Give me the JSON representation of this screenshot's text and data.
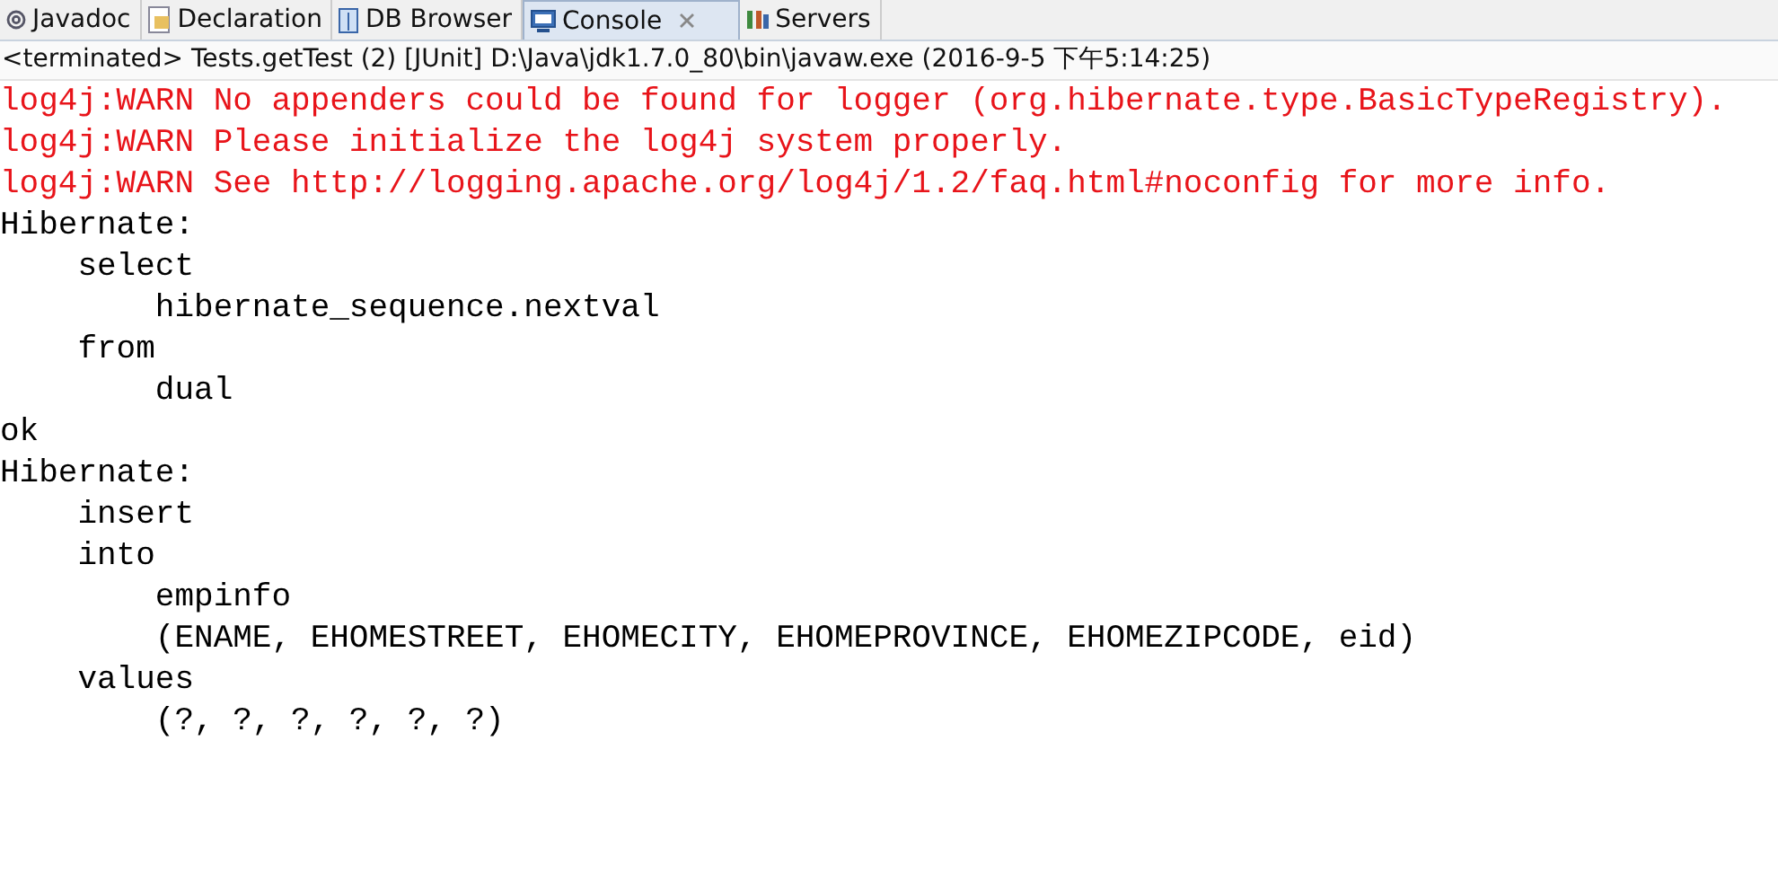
{
  "tabs": [
    {
      "label": "Javadoc",
      "kind": "javadoc",
      "selected": false,
      "closable": false
    },
    {
      "label": "Declaration",
      "kind": "declaration",
      "selected": false,
      "closable": false
    },
    {
      "label": "DB Browser",
      "kind": "db",
      "selected": false,
      "closable": false
    },
    {
      "label": "Console",
      "kind": "console",
      "selected": true,
      "closable": true
    },
    {
      "label": "Servers",
      "kind": "servers",
      "selected": false,
      "closable": false
    }
  ],
  "status": "<terminated> Tests.getTest (2) [JUnit] D:\\Java\\jdk1.7.0_80\\bin\\javaw.exe (2016-9-5 下午5:14:25)",
  "console": [
    {
      "text": "log4j:WARN No appenders could be found for logger (org.hibernate.type.BasicTypeRegistry).",
      "kind": "error"
    },
    {
      "text": "log4j:WARN Please initialize the log4j system properly.",
      "kind": "error"
    },
    {
      "text": "log4j:WARN See http://logging.apache.org/log4j/1.2/faq.html#noconfig for more info.",
      "kind": "error"
    },
    {
      "text": "Hibernate: ",
      "kind": "out"
    },
    {
      "text": "    select",
      "kind": "out"
    },
    {
      "text": "        hibernate_sequence.nextval ",
      "kind": "out"
    },
    {
      "text": "    from",
      "kind": "out"
    },
    {
      "text": "        dual",
      "kind": "out"
    },
    {
      "text": "ok",
      "kind": "out"
    },
    {
      "text": "Hibernate: ",
      "kind": "out"
    },
    {
      "text": "    insert ",
      "kind": "out"
    },
    {
      "text": "    into",
      "kind": "out"
    },
    {
      "text": "        empinfo",
      "kind": "out"
    },
    {
      "text": "        (ENAME, EHOMESTREET, EHOMECITY, EHOMEPROVINCE, EHOMEZIPCODE, eid) ",
      "kind": "out"
    },
    {
      "text": "    values",
      "kind": "out"
    },
    {
      "text": "        (?, ?, ?, ?, ?, ?)",
      "kind": "out"
    }
  ]
}
